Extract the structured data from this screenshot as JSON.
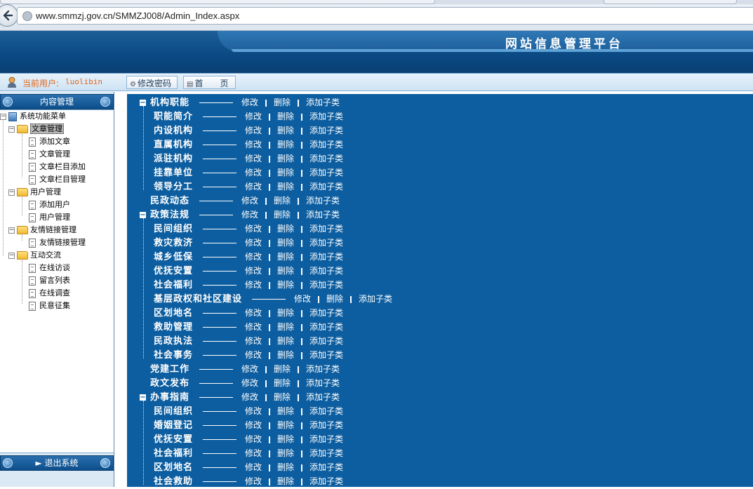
{
  "browser": {
    "url": "www.smmzj.gov.cn/SMMZJ008/Admin_Index.aspx"
  },
  "banner": {
    "title": "网站信息管理平台"
  },
  "userbar": {
    "current_user_label": "当前用户:",
    "username": "luolibin",
    "change_password": "修改密码",
    "home": "首　　页"
  },
  "sidebar": {
    "header": "内容管理",
    "footer": "► 退出系统",
    "root": "系统功能菜单",
    "groups": [
      {
        "label": "文章管理",
        "items": [
          "添加文章",
          "文章管理",
          "文章栏目添加",
          "文章栏目管理"
        ]
      },
      {
        "label": "用户管理",
        "items": [
          "添加用户",
          "用户管理"
        ]
      },
      {
        "label": "友情链接管理",
        "items": [
          "友情链接管理"
        ]
      },
      {
        "label": "互动交流",
        "items": [
          "在线访谈",
          "留言列表",
          "在线调查",
          "民意征集"
        ]
      }
    ]
  },
  "actions": {
    "edit": "修改",
    "delete": "删除",
    "add_child": "添加子类"
  },
  "categories": [
    {
      "name": "机构职能",
      "level": 0,
      "expandable": true
    },
    {
      "name": "职能简介",
      "level": 1
    },
    {
      "name": "内设机构",
      "level": 1
    },
    {
      "name": "直属机构",
      "level": 1
    },
    {
      "name": "派驻机构",
      "level": 1
    },
    {
      "name": "挂靠单位",
      "level": 1
    },
    {
      "name": "领导分工",
      "level": 1
    },
    {
      "name": "民政动态",
      "level": 0,
      "expandable": false
    },
    {
      "name": "政策法规",
      "level": 0,
      "expandable": true
    },
    {
      "name": "民间组织",
      "level": 1
    },
    {
      "name": "救灾救济",
      "level": 1
    },
    {
      "name": "城乡低保",
      "level": 1
    },
    {
      "name": "优抚安置",
      "level": 1
    },
    {
      "name": "社会福利",
      "level": 1
    },
    {
      "name": "基层政权和社区建设",
      "level": 1
    },
    {
      "name": "区划地名",
      "level": 1
    },
    {
      "name": "救助管理",
      "level": 1
    },
    {
      "name": "民政执法",
      "level": 1
    },
    {
      "name": "社会事务",
      "level": 1
    },
    {
      "name": "党建工作",
      "level": 0,
      "expandable": false
    },
    {
      "name": "政文发布",
      "level": 0,
      "expandable": false
    },
    {
      "name": "办事指南",
      "level": 0,
      "expandable": true
    },
    {
      "name": "民间组织",
      "level": 1
    },
    {
      "name": "婚姻登记",
      "level": 1
    },
    {
      "name": "优抚安置",
      "level": 1
    },
    {
      "name": "社会福利",
      "level": 1
    },
    {
      "name": "区划地名",
      "level": 1
    },
    {
      "name": "社会救助",
      "level": 1
    }
  ]
}
